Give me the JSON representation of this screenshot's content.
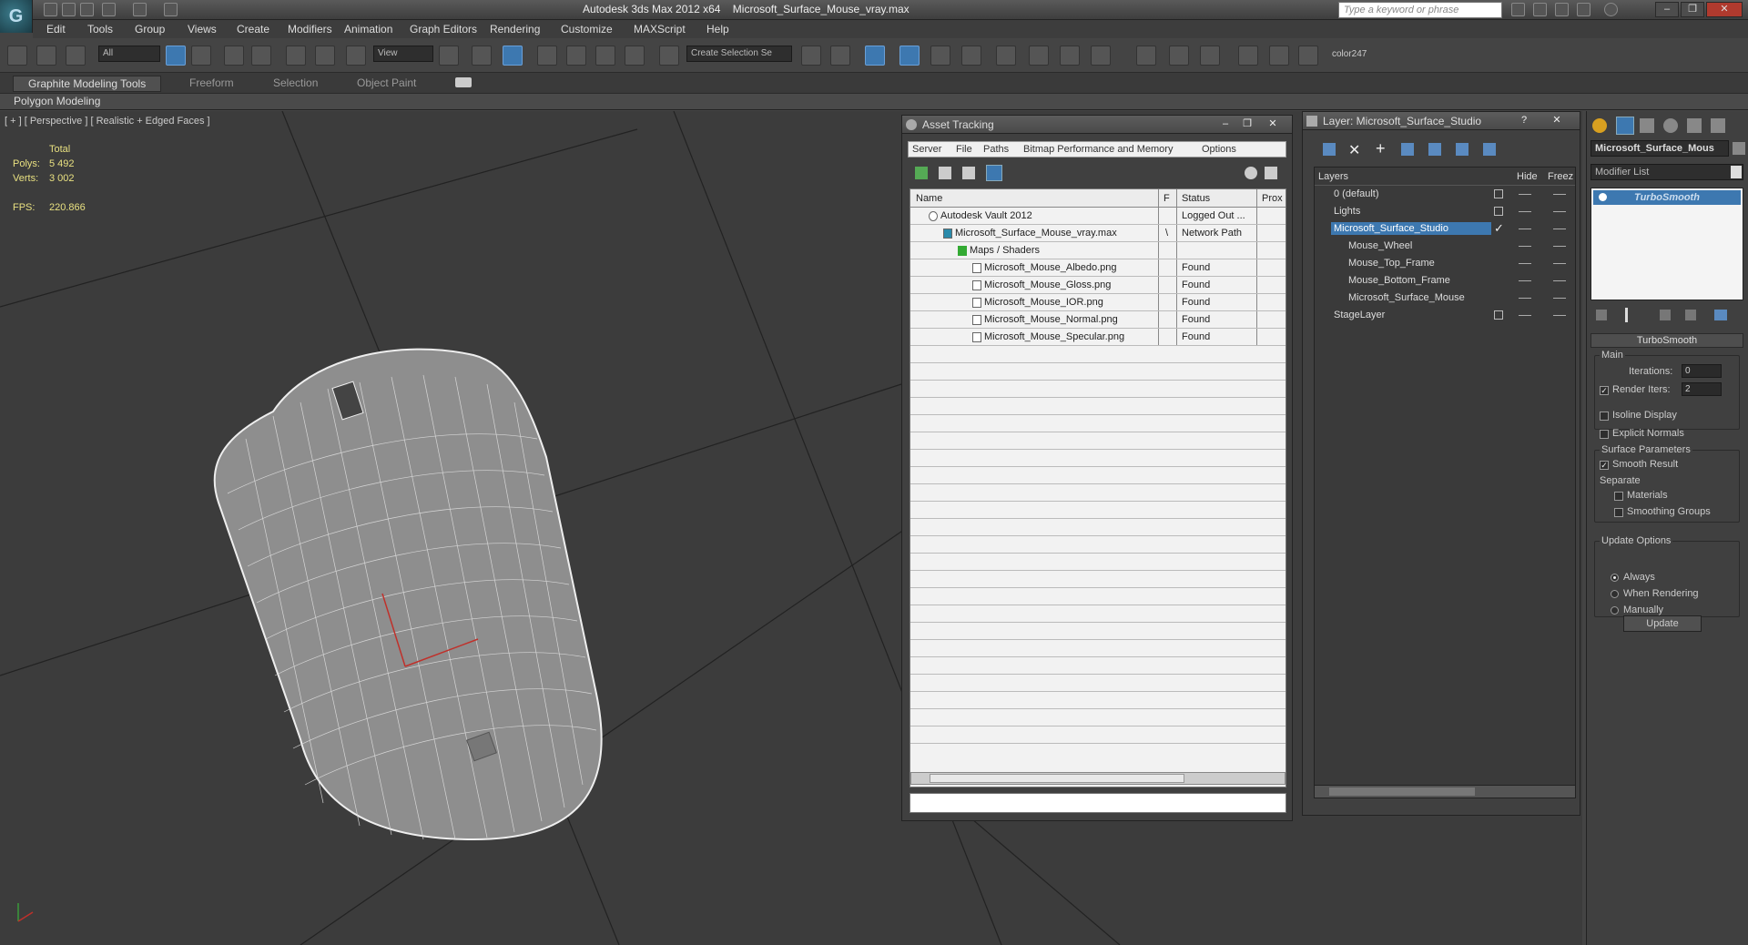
{
  "titlebar": {
    "app": "Autodesk 3ds Max  2012 x64",
    "file": "Microsoft_Surface_Mouse_vray.max",
    "search_placeholder": "Type a keyword or phrase",
    "window_buttons": [
      "–",
      "❐",
      "✕"
    ]
  },
  "menu": [
    "Edit",
    "Tools",
    "Group",
    "Views",
    "Create",
    "Modifiers",
    "Animation",
    "Graph Editors",
    "Rendering",
    "Customize",
    "MAXScript",
    "Help"
  ],
  "toolbar": {
    "selection_filter": "All",
    "ref_coord": "View",
    "named_selection": "Create Selection Se",
    "color_label": "color247"
  },
  "ribbon": {
    "tabs": [
      "Graphite Modeling Tools",
      "Freeform",
      "Selection",
      "Object Paint"
    ],
    "panel_label": "Polygon Modeling"
  },
  "viewport": {
    "label": "[ + ] [ Perspective ] [ Realistic + Edged Faces ]",
    "stats": {
      "total_label": "Total",
      "polys_label": "Polys:",
      "polys_value": "5 492",
      "verts_label": "Verts:",
      "verts_value": "3 002",
      "fps_label": "FPS:",
      "fps_value": "220.866"
    }
  },
  "asset_tracking": {
    "title": "Asset Tracking",
    "menu": [
      "Server",
      "File",
      "Paths",
      "Bitmap Performance and Memory",
      "Options"
    ],
    "columns": [
      "Name",
      "F",
      "Status",
      "Prox"
    ],
    "rows": [
      {
        "name": "Autodesk Vault 2012",
        "f": "",
        "status": "Logged Out ..."
      },
      {
        "name": "Microsoft_Surface_Mouse_vray.max",
        "f": "\\",
        "status": "Network Path"
      },
      {
        "name": "Maps / Shaders",
        "f": "",
        "status": ""
      },
      {
        "name": "Microsoft_Mouse_Albedo.png",
        "f": "",
        "status": "Found"
      },
      {
        "name": "Microsoft_Mouse_Gloss.png",
        "f": "",
        "status": "Found"
      },
      {
        "name": "Microsoft_Mouse_IOR.png",
        "f": "",
        "status": "Found"
      },
      {
        "name": "Microsoft_Mouse_Normal.png",
        "f": "",
        "status": "Found"
      },
      {
        "name": "Microsoft_Mouse_Specular.png",
        "f": "",
        "status": "Found"
      }
    ]
  },
  "layer_manager": {
    "title": "Layer: Microsoft_Surface_Studio",
    "columns": [
      "Layers",
      "Hide",
      "Freez"
    ],
    "layers": [
      {
        "name": "0 (default)",
        "indent": 0
      },
      {
        "name": "Lights",
        "indent": 0
      },
      {
        "name": "Microsoft_Surface_Studio",
        "indent": 0,
        "selected": true
      },
      {
        "name": "Mouse_Wheel",
        "indent": 1
      },
      {
        "name": "Mouse_Top_Frame",
        "indent": 1
      },
      {
        "name": "Mouse_Bottom_Frame",
        "indent": 1
      },
      {
        "name": "Microsoft_Surface_Mouse",
        "indent": 1
      },
      {
        "name": "StageLayer",
        "indent": 0
      }
    ]
  },
  "command_panel": {
    "object_name": "Microsoft_Surface_Mous",
    "modifier_list": "Modifier List",
    "stack_item": "TurboSmooth",
    "rollout_title": "TurboSmooth",
    "main_label": "Main",
    "iterations_label": "Iterations:",
    "iterations_value": "0",
    "render_iters_label": "Render Iters:",
    "render_iters_value": "2",
    "isoline_label": "Isoline Display",
    "explicit_normals_label": "Explicit Normals",
    "surface_params_label": "Surface Parameters",
    "smooth_result_label": "Smooth Result",
    "separate_label": "Separate",
    "materials_label": "Materials",
    "smoothing_groups_label": "Smoothing Groups",
    "update_options_label": "Update Options",
    "always_label": "Always",
    "when_rendering_label": "When Rendering",
    "manually_label": "Manually",
    "update_button": "Update"
  }
}
